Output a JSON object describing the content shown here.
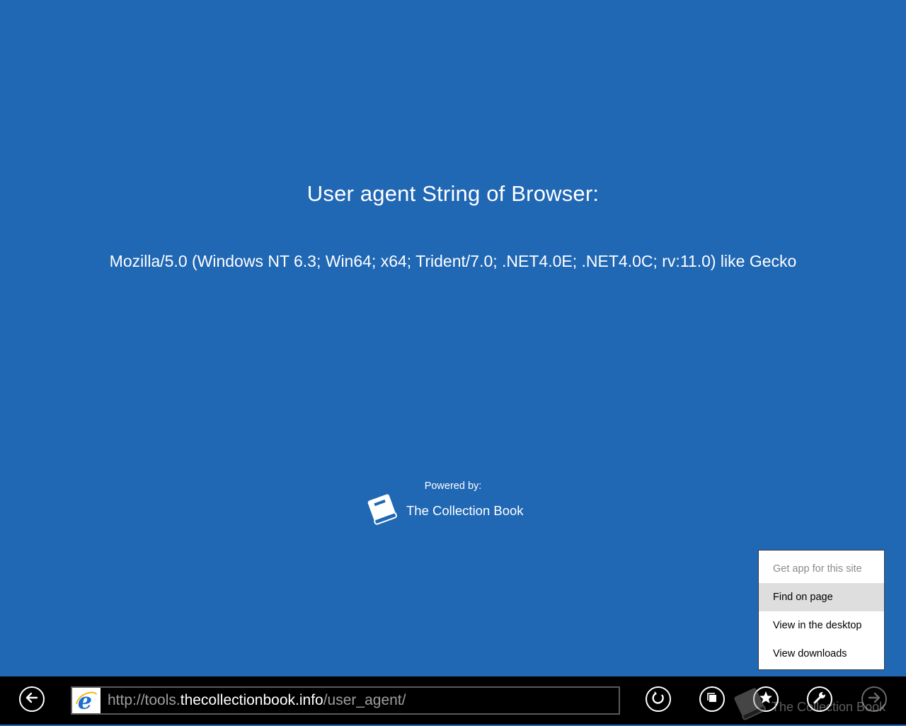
{
  "page": {
    "heading": "User agent String of Browser:",
    "user_agent": "Mozilla/5.0 (Windows NT 6.3; Win64; x64; Trident/7.0; .NET4.0E; .NET4.0C; rv:11.0) like Gecko",
    "powered_by": "Powered by:",
    "brand_name": "The Collection Book",
    "brand_icon": "book-icon"
  },
  "context_menu": {
    "items": [
      {
        "label": "Get app for this site",
        "state": "disabled"
      },
      {
        "label": "Find on page",
        "state": "highlighted"
      },
      {
        "label": "View in the desktop",
        "state": "normal"
      },
      {
        "label": "View downloads",
        "state": "normal"
      }
    ]
  },
  "app_bar": {
    "url_prefix": "http://tools.",
    "url_host": "thecollectionbook.info",
    "url_path": "/user_agent/",
    "buttons": [
      "back-icon",
      "refresh-icon",
      "tabs-icon",
      "favorites-icon",
      "tools-icon",
      "forward-icon"
    ],
    "watermark_text": "The Collection Book"
  },
  "colors": {
    "background": "#2067b4",
    "app_bar": "#000000",
    "menu_highlight": "#dedede"
  }
}
